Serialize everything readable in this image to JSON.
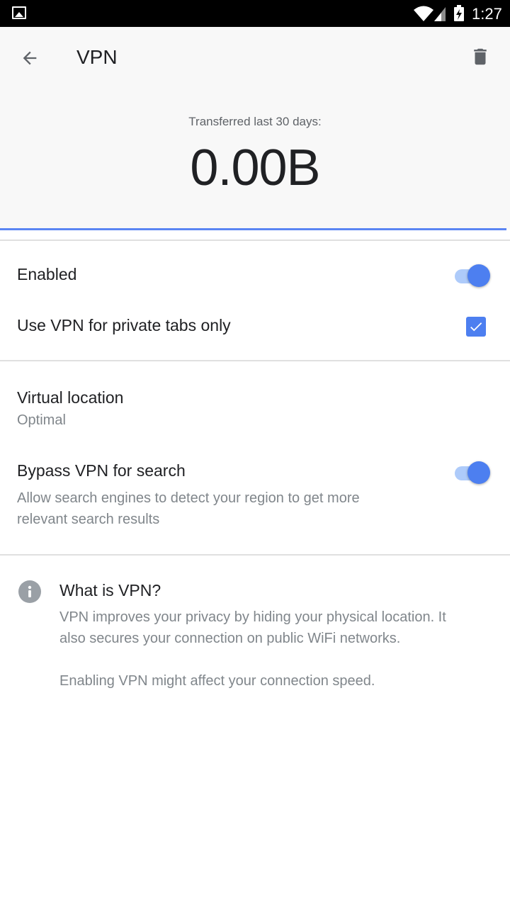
{
  "status_bar": {
    "time": "1:27",
    "icons": [
      "gallery-notification-icon",
      "wifi-icon",
      "signal-icon",
      "battery-charging-icon"
    ]
  },
  "header": {
    "title": "VPN",
    "transferred_label": "Transferred last 30 days:",
    "transferred_value": "0.00B"
  },
  "settings": {
    "enabled": {
      "label": "Enabled",
      "on": true
    },
    "private_tabs": {
      "label": "Use VPN for private tabs only",
      "checked": true
    },
    "virtual_location": {
      "label": "Virtual location",
      "value": "Optimal"
    },
    "bypass_search": {
      "label": "Bypass VPN for search",
      "description_line1": "Allow search engines to detect your region to get more",
      "description_line2": "relevant search results",
      "on": true
    }
  },
  "info": {
    "title": "What is VPN?",
    "paragraph1_line1": "VPN improves your privacy by hiding your physical location. It",
    "paragraph1_line2": "also secures your connection on public WiFi networks.",
    "paragraph2": "Enabling VPN might affect your connection speed."
  },
  "colors": {
    "accent": "#4d7ff0",
    "track": "#aecbfa",
    "header_bg": "#f8f8f8",
    "secondary_text": "#80868b"
  }
}
